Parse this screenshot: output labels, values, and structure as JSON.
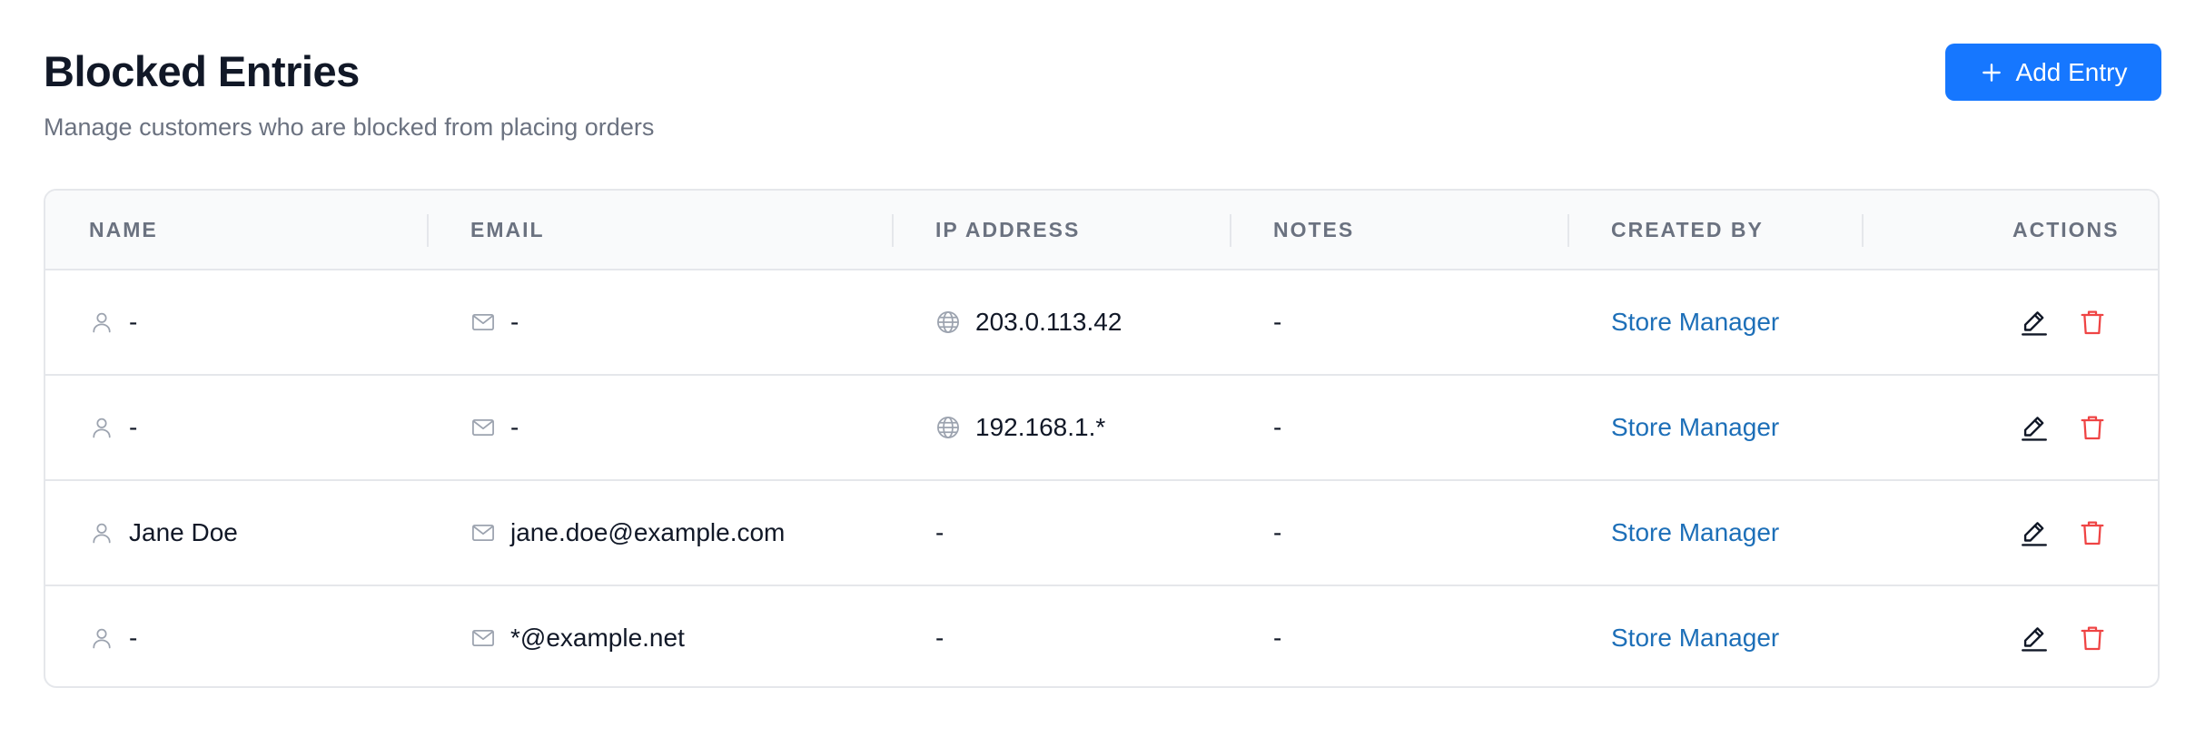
{
  "header": {
    "title": "Blocked Entries",
    "subtitle": "Manage customers who are blocked from placing orders",
    "add_button_label": "Add Entry"
  },
  "table": {
    "columns": [
      "NAME",
      "EMAIL",
      "IP ADDRESS",
      "NOTES",
      "CREATED BY",
      "ACTIONS"
    ],
    "rows": [
      {
        "name": "-",
        "email": "-",
        "ip": "203.0.113.42",
        "notes": "-",
        "created_by": "Store Manager",
        "ip_icon": true
      },
      {
        "name": "-",
        "email": "-",
        "ip": "192.168.1.*",
        "notes": "-",
        "created_by": "Store Manager",
        "ip_icon": true
      },
      {
        "name": "Jane Doe",
        "email": "jane.doe@example.com",
        "ip": "-",
        "notes": "-",
        "created_by": "Store Manager",
        "ip_icon": false
      },
      {
        "name": "-",
        "email": "*@example.net",
        "ip": "-",
        "notes": "-",
        "created_by": "Store Manager",
        "ip_icon": false
      }
    ]
  },
  "icons": {
    "add": "plus-icon",
    "name": "user-icon",
    "email": "mail-icon",
    "ip": "globe-icon",
    "edit": "pencil-icon",
    "delete": "trash-icon"
  },
  "colors": {
    "primary": "#1677ff",
    "link": "#1d6fb8",
    "danger": "#ef4444",
    "muted": "#6b7280"
  }
}
